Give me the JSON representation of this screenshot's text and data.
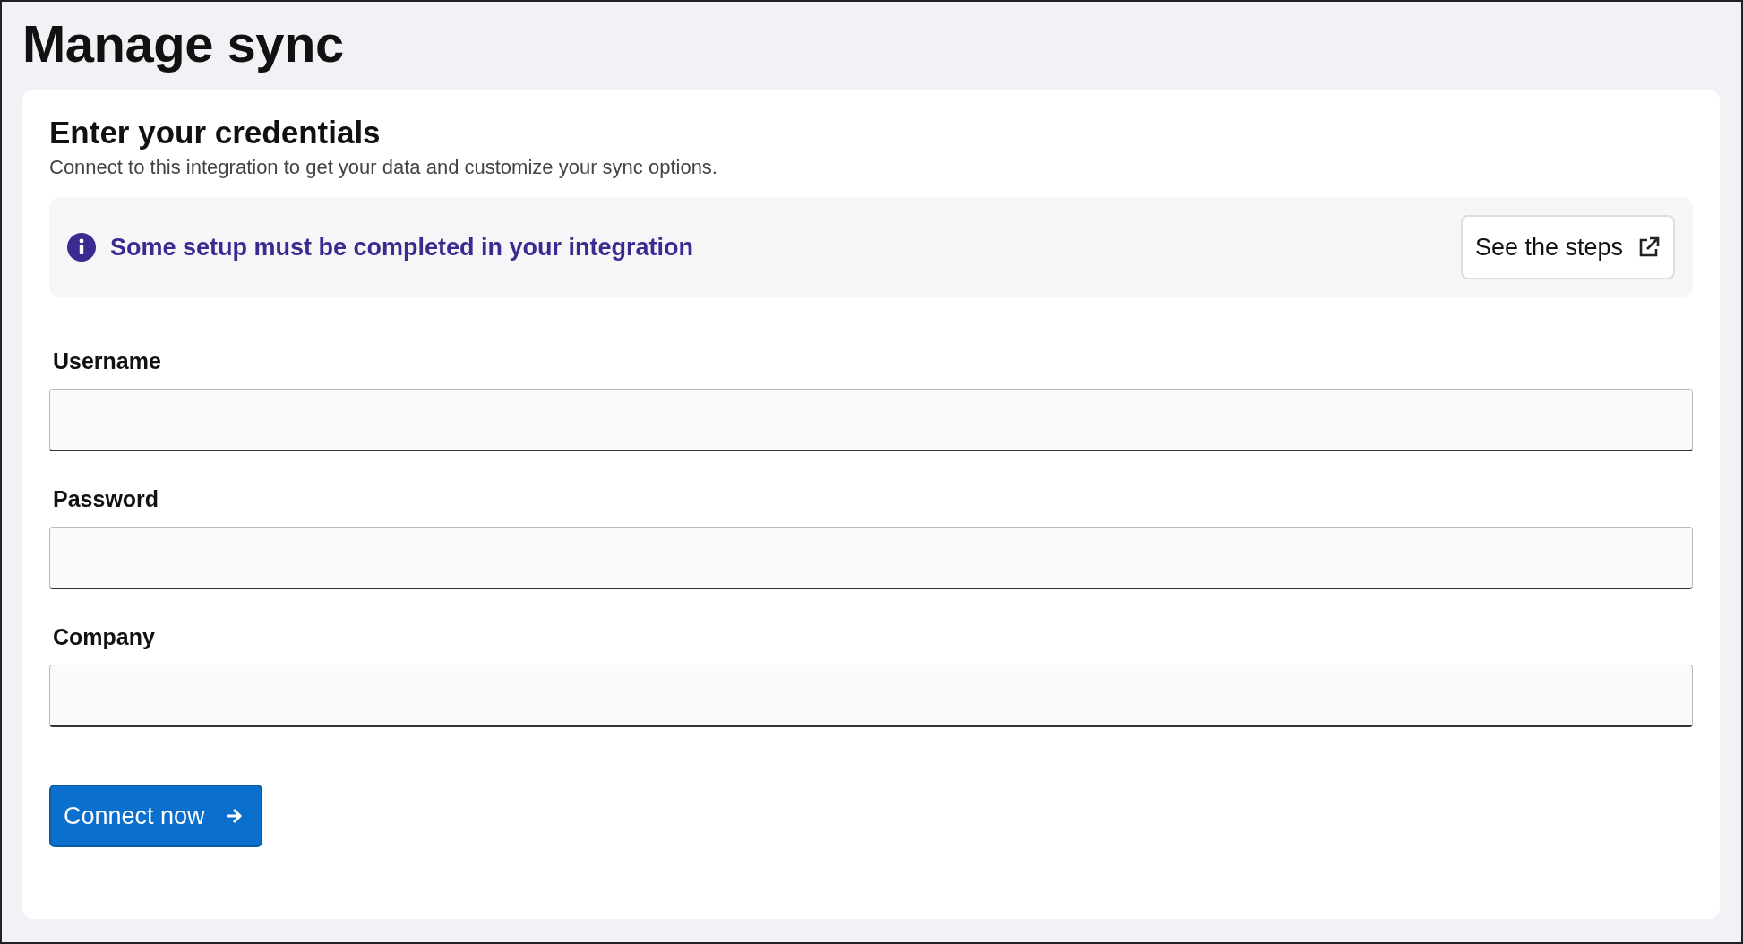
{
  "page": {
    "title": "Manage sync"
  },
  "card": {
    "title": "Enter your credentials",
    "subtitle": "Connect to this integration to get your data and customize your sync options."
  },
  "notice": {
    "message": "Some setup must be completed in your integration",
    "button": "See the steps"
  },
  "fields": [
    {
      "label": "Username"
    },
    {
      "label": "Password"
    },
    {
      "label": "Company"
    }
  ],
  "submit": {
    "label": "Connect now"
  }
}
